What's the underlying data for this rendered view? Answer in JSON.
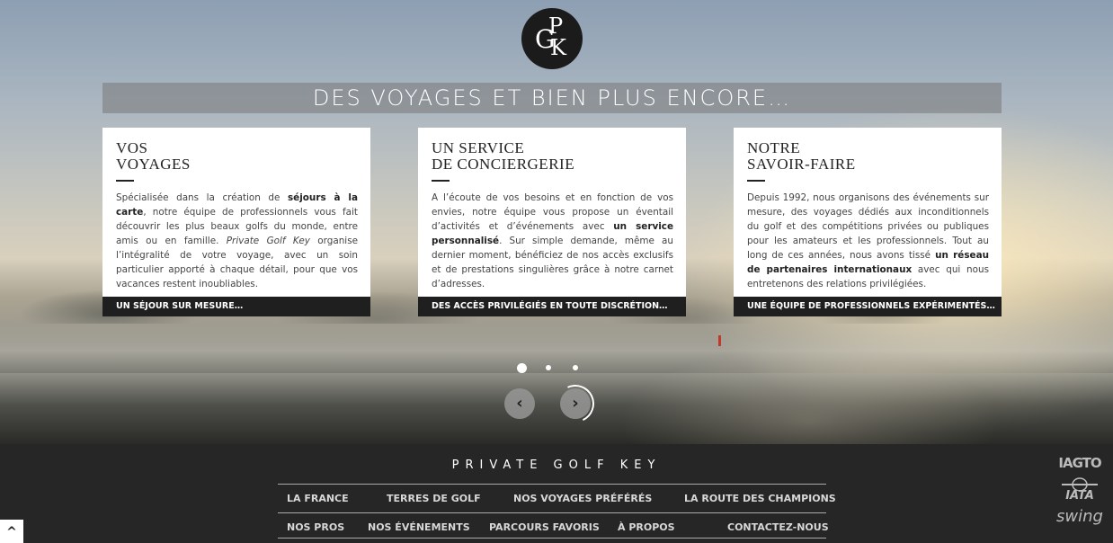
{
  "logo": {
    "letter_g": "G",
    "letter_p": "P",
    "letter_k": "K"
  },
  "hero": {
    "tagline": "DES VOYAGES ET BIEN PLUS ENCORE…"
  },
  "cards": [
    {
      "title_line1": "VOS",
      "title_line2": "VOYAGES",
      "body_parts": [
        {
          "t": "Spécialisée dans la création de ",
          "s": "n"
        },
        {
          "t": "séjours à la carte",
          "s": "b"
        },
        {
          "t": ", notre équipe de professionnels vous fait découvrir les plus beaux golfs du monde, entre amis ou en famille. ",
          "s": "n"
        },
        {
          "t": "Private Golf Key",
          "s": "i"
        },
        {
          "t": " organise l’intégralité de votre voyage, avec un soin particulier apporté à chaque détail, pour que vos vacances restent inoubliables.",
          "s": "n"
        }
      ],
      "footer": "UN SÉJOUR SUR MESURE…"
    },
    {
      "title_line1": "UN SERVICE",
      "title_line2": "DE CONCIERGERIE",
      "body_parts": [
        {
          "t": "A l’écoute de vos besoins et en fonction de vos envies, notre équipe vous propose un éventail d’activités et d’événements avec ",
          "s": "n"
        },
        {
          "t": "un service personnalisé",
          "s": "b"
        },
        {
          "t": ". Sur simple demande, même au dernier moment, bénéficiez de nos accès exclusifs et de prestations singulières grâce à notre carnet d’adresses.",
          "s": "n"
        }
      ],
      "footer": "DES ACCÈS PRIVILÉGIÉS EN TOUTE DISCRÉTION…"
    },
    {
      "title_line1": "NOTRE",
      "title_line2": "SAVOIR-FAIRE",
      "body_parts": [
        {
          "t": "Depuis 1992, nous organisons des événements sur mesure, des voyages dédiés aux inconditionnels du golf et des compétitions privées ou publiques pour les amateurs et les professionnels. Tout au long de ces années, nous avons tissé ",
          "s": "n"
        },
        {
          "t": "un réseau de partenaires internationaux",
          "s": "b"
        },
        {
          "t": " avec qui nous entretenons des relations privilégiées.",
          "s": "n"
        }
      ],
      "footer": "UNE ÉQUIPE DE PROFESSIONNELS EXPÉRIMENTÉS…"
    }
  ],
  "carousel": {
    "active_slide": 1,
    "slide_count": 3,
    "prev_icon": "‹",
    "next_icon": "›"
  },
  "footer": {
    "brand": "PRIVATE GOLF KEY",
    "nav_row1": [
      "LA FRANCE",
      "TERRES DE GOLF",
      "NOS VOYAGES PRÉFÉRÉS",
      "LA ROUTE DES CHAMPIONS"
    ],
    "nav_row2": [
      "NOS PROS",
      "NOS ÉVÉNEMENTS",
      "PARCOURS FAVORIS",
      "À PROPOS",
      "CONTACTEZ-NOUS"
    ],
    "partners": [
      "IAGTO",
      "IATA",
      "swing"
    ]
  },
  "scroll_top_icon": "^"
}
